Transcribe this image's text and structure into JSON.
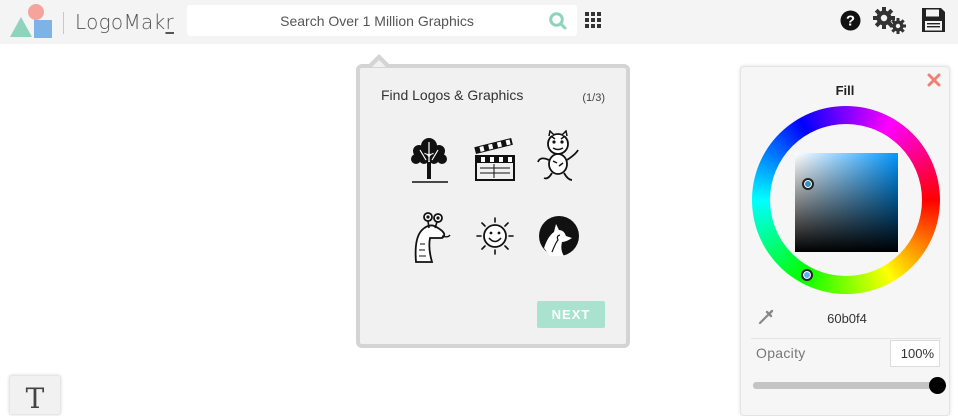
{
  "app": {
    "name_prefix": "LogoMak",
    "name_suffix": "r"
  },
  "search": {
    "placeholder": "Search Over 1 Million Graphics"
  },
  "toolbar": {
    "icons": [
      "apps-grid-icon",
      "help-icon",
      "settings-gears-icon",
      "save-icon"
    ]
  },
  "tutorial": {
    "title": "Find Logos & Graphics",
    "step": "(1/3)",
    "graphics": [
      "tree-graphic",
      "clapperboard-graphic",
      "tiger-graphic",
      "snake-graphic",
      "sun-graphic",
      "wolf-moon-graphic"
    ],
    "next_label": "NEXT"
  },
  "fill_panel": {
    "title": "Fill",
    "hex": "60b0f4",
    "opacity_label": "Opacity",
    "opacity_value": "100%",
    "opacity_level": 1.0
  },
  "tools": {
    "text_tool_glyph": "T"
  },
  "colors": {
    "logo_triangle": "#8fd3bd",
    "logo_circle": "#f4a49a",
    "logo_square": "#7fb2e5",
    "next_button": "#a9e2cf",
    "selected_fill": "#60b0f4",
    "close_icon": "#f08070"
  }
}
